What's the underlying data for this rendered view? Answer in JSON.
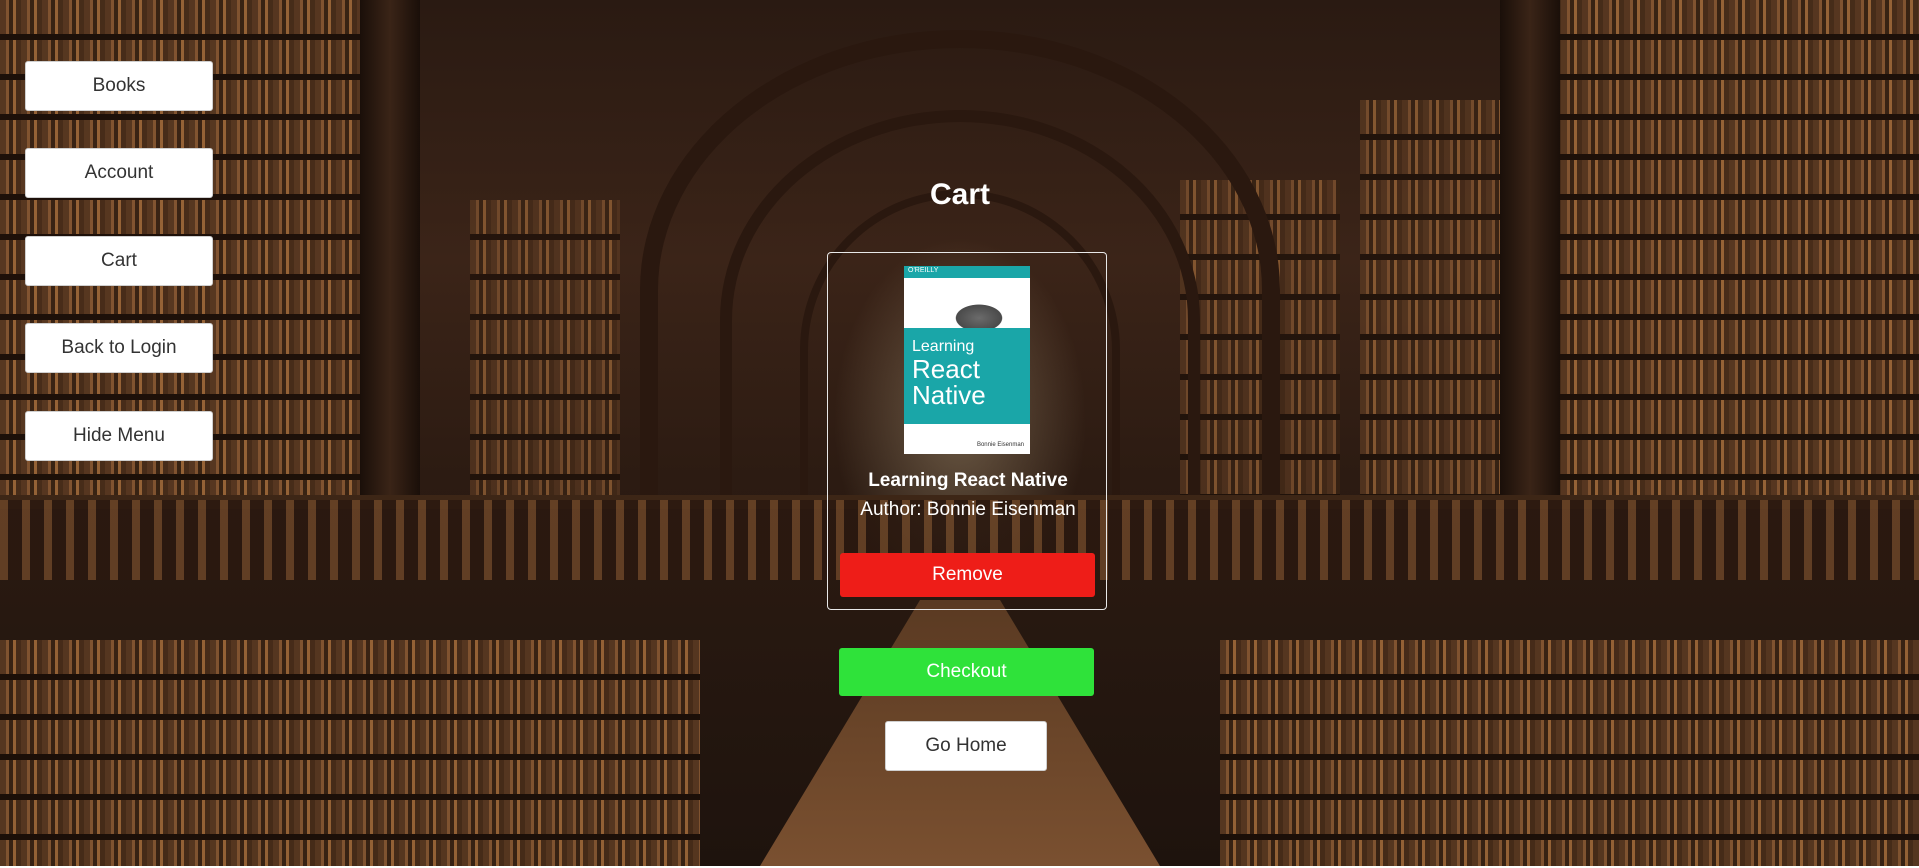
{
  "menu": {
    "items": [
      {
        "label": "Books"
      },
      {
        "label": "Account"
      },
      {
        "label": "Cart"
      },
      {
        "label": "Back to Login"
      },
      {
        "label": "Hide Menu"
      }
    ]
  },
  "cart": {
    "title": "Cart",
    "items": [
      {
        "title": "Learning React Native",
        "author": "Author: Bonnie Eisenman",
        "remove_label": "Remove",
        "cover": {
          "publisher": "O'REILLY",
          "line1": "Learning",
          "line2": "React",
          "line3": "Native",
          "author_small": "Bonnie Eisenman"
        }
      }
    ],
    "checkout_label": "Checkout",
    "home_label": "Go Home"
  },
  "colors": {
    "remove": "#ee1d18",
    "checkout": "#2fe23a",
    "cover_teal": "#1aa6a8"
  },
  "icons": [
    "library-background-image",
    "book-cover-image"
  ]
}
